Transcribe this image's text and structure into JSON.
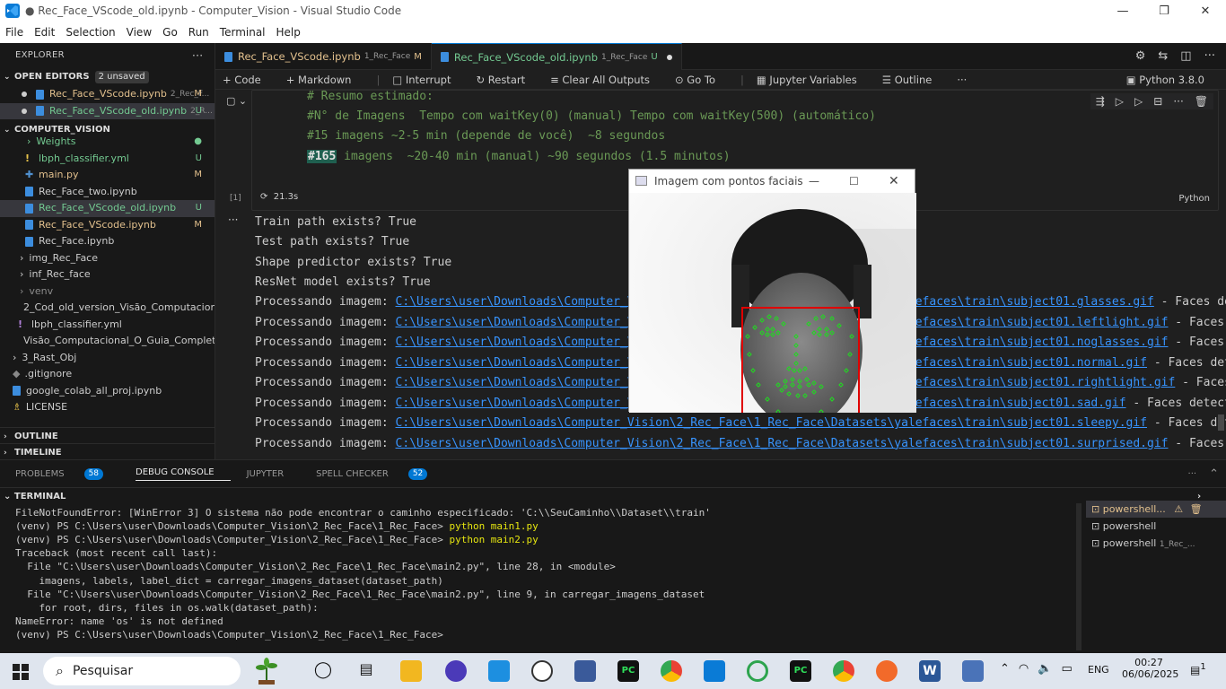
{
  "window": {
    "title": "● Rec_Face_VScode_old.ipynb - Computer_Vision - Visual Studio Code"
  },
  "menu": [
    "File",
    "Edit",
    "Selection",
    "View",
    "Go",
    "Run",
    "Terminal",
    "Help"
  ],
  "sidebar": {
    "header": "EXPLORER",
    "open_editors": {
      "label": "OPEN EDITORS",
      "badge": "2 unsaved"
    },
    "open_files": [
      {
        "name": "Rec_Face_VScode.ipynb",
        "sub": "2_Rec_F...",
        "status": "M"
      },
      {
        "name": "Rec_Face_VScode_old.ipynb",
        "sub": "2_R...",
        "status": "U"
      }
    ],
    "project": "COMPUTER_VISION",
    "tree": [
      {
        "name": "Weights",
        "status": "●"
      },
      {
        "name": "lbph_classifier.yml",
        "status": "U"
      },
      {
        "name": "main.py",
        "status": "M"
      },
      {
        "name": "Rec_Face_two.ipynb",
        "status": ""
      },
      {
        "name": "Rec_Face_VScode_old.ipynb",
        "status": "U"
      },
      {
        "name": "Rec_Face_VScode.ipynb",
        "status": "M"
      },
      {
        "name": "Rec_Face.ipynb",
        "status": ""
      },
      {
        "name": "img_Rec_Face",
        "status": ""
      },
      {
        "name": "inf_Rec_face",
        "status": ""
      },
      {
        "name": "venv",
        "status": ""
      },
      {
        "name": "2_Cod_old_version_Visão_Computacional...",
        "status": ""
      },
      {
        "name": "lbph_classifier.yml",
        "status": ""
      },
      {
        "name": "Visão_Computacional_O_Guia_Completo...",
        "status": ""
      },
      {
        "name": "3_Rast_Obj",
        "status": ""
      },
      {
        "name": ".gitignore",
        "status": ""
      },
      {
        "name": "google_colab_all_proj.ipynb",
        "status": ""
      },
      {
        "name": "LICENSE",
        "status": ""
      }
    ],
    "outline": "OUTLINE",
    "timeline": "TIMELINE"
  },
  "tabs": [
    {
      "label": "Rec_Face_VScode.ipynb",
      "sub": "1_Rec_Face",
      "status": "M"
    },
    {
      "label": "Rec_Face_VScode_old.ipynb",
      "sub": "1_Rec_Face",
      "status": "U"
    }
  ],
  "toolbar": {
    "code": "Code",
    "markdown": "Markdown",
    "interrupt": "Interrupt",
    "restart": "Restart",
    "clear": "Clear All Outputs",
    "goto": "Go To",
    "vars": "Jupyter Variables",
    "outline": "Outline",
    "kernel": "Python 3.8.0"
  },
  "cell": {
    "lines": [
      "# Resumo estimado:",
      "#N° de Imagens  Tempo com waitKey(0) (manual) Tempo com waitKey(500) (automático)",
      "#15 imagens ~2-5 min (depende de você)  ~8 segundos"
    ],
    "highlight": "#165",
    "line4_rest": " imagens  ~20-40 min (manual) ~90 segundos (1.5 minutos)",
    "exec_count": "[1]",
    "exec_time": "21.3s",
    "lang": "Python"
  },
  "output": {
    "lines_plain": [
      "Train path exists? True",
      "Test path exists? True",
      "Shape predictor exists? True",
      "ResNet model exists? True"
    ],
    "proc_prefix": "Processando imagem: ",
    "proc_rows": [
      {
        "path": "C:\\Users\\user\\Downloads\\Computer_Vision\\2_Rec_Face\\1_Rec_Face\\Datasets\\yalefaces\\train\\subject01.glasses.gif",
        "suffix": " - Faces detect"
      },
      {
        "path": "C:\\Users\\user\\Downloads\\Computer_Vision\\2_Rec_Face\\1_Rec_Face\\Datasets\\yalefaces\\train\\subject01.leftlight.gif",
        "suffix": " - Faces dete"
      },
      {
        "path": "C:\\Users\\user\\Downloads\\Computer_Vision\\2_Rec_Face\\1_Rec_Face\\Datasets\\yalefaces\\train\\subject01.noglasses.gif",
        "suffix": " - Faces dete"
      },
      {
        "path": "C:\\Users\\user\\Downloads\\Computer_Vision\\2_Rec_Face\\1_Rec_Face\\Datasets\\yalefaces\\train\\subject01.normal.gif",
        "suffix": " - Faces detecta"
      },
      {
        "path": "C:\\Users\\user\\Downloads\\Computer_Vision\\2_Rec_Face\\1_Rec_Face\\Datasets\\yalefaces\\train\\subject01.rightlight.gif",
        "suffix": " - Faces de"
      },
      {
        "path": "C:\\Users\\user\\Downloads\\Computer_Vision\\2_Rec_Face\\1_Rec_Face\\Datasets\\yalefaces\\train\\subject01.sad.gif",
        "suffix": " - Faces detectadas"
      },
      {
        "path": "C:\\Users\\user\\Downloads\\Computer_Vision\\2_Rec_Face\\1_Rec_Face\\Datasets\\yalefaces\\train\\subject01.sleepy.gif",
        "suffix": " - Faces detecta"
      },
      {
        "path": "C:\\Users\\user\\Downloads\\Computer_Vision\\2_Rec_Face\\1_Rec_Face\\Datasets\\yalefaces\\train\\subject01.surprised.gif",
        "suffix": " - Faces dete"
      }
    ]
  },
  "image_window": {
    "title": "Imagem com pontos faciais"
  },
  "panel": {
    "tabs": [
      {
        "label": "PROBLEMS",
        "badge": "58"
      },
      {
        "label": "DEBUG CONSOLE",
        "badge": ""
      },
      {
        "label": "JUPYTER",
        "badge": ""
      },
      {
        "label": "SPELL CHECKER",
        "badge": "52"
      }
    ],
    "terminal_label": "TERMINAL",
    "terminal_lines": [
      "FileNotFoundError: [WinError 3] O sistema não pode encontrar o caminho especificado: 'C:\\\\SeuCaminho\\\\Dataset\\\\train'",
      "(venv) PS C:\\Users\\user\\Downloads\\Computer_Vision\\2_Rec_Face\\1_Rec_Face> python main1.py",
      "(venv) PS C:\\Users\\user\\Downloads\\Computer_Vision\\2_Rec_Face\\1_Rec_Face> python main2.py",
      "Traceback (most recent call last):",
      "  File \"C:\\Users\\user\\Downloads\\Computer_Vision\\2_Rec_Face\\1_Rec_Face\\main2.py\", line 28, in <module>",
      "    imagens, labels, label_dict = carregar_imagens_dataset(dataset_path)",
      "  File \"C:\\Users\\user\\Downloads\\Computer_Vision\\2_Rec_Face\\1_Rec_Face\\main2.py\", line 9, in carregar_imagens_dataset",
      "    for root, dirs, files in os.walk(dataset_path):",
      "NameError: name 'os' is not defined",
      "(venv) PS C:\\Users\\user\\Downloads\\Computer_Vision\\2_Rec_Face\\1_Rec_Face> "
    ],
    "terminals": [
      {
        "label": "powershell...",
        "sub": ""
      },
      {
        "label": "powershell",
        "sub": ""
      },
      {
        "label": "powershell",
        "sub": "1_Rec_..."
      }
    ]
  },
  "taskbar": {
    "search": "Pesquisar",
    "lang": "ENG",
    "time": "00:27",
    "date": "06/06/2025",
    "notif": "1"
  }
}
